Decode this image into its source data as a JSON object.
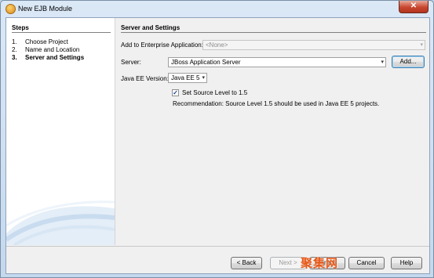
{
  "window": {
    "title": "New EJB Module",
    "close_glyph": "✕"
  },
  "steps": {
    "heading": "Steps",
    "items": [
      {
        "num": "1.",
        "label": "Choose Project"
      },
      {
        "num": "2.",
        "label": "Name and Location"
      },
      {
        "num": "3.",
        "label": "Server and Settings"
      }
    ],
    "active_index": 2
  },
  "main": {
    "heading": "Server and Settings",
    "enterprise_app": {
      "label": "Add to Enterprise Application:",
      "value": "<None>"
    },
    "server": {
      "label": "Server:",
      "value": "JBoss Application Server",
      "add_button": "Add..."
    },
    "java_ee": {
      "label": "Java EE Version:",
      "value": "Java EE 5"
    },
    "source_level": {
      "label": "Set Source Level to 1.5",
      "checked": true,
      "check_glyph": "✓"
    },
    "recommendation": "Recommendation: Source Level 1.5 should be used in Java EE 5 projects."
  },
  "footer": {
    "back": "< Back",
    "next": "Next >",
    "finish": "Finish",
    "cancel": "Cancel",
    "help": "Help"
  },
  "watermark": "聚集网",
  "icons": {
    "dropdown": "▾"
  },
  "colors": {
    "title_bar": "#c4d8ee",
    "close_button": "#c8462f",
    "watermark": "#e5591a"
  }
}
